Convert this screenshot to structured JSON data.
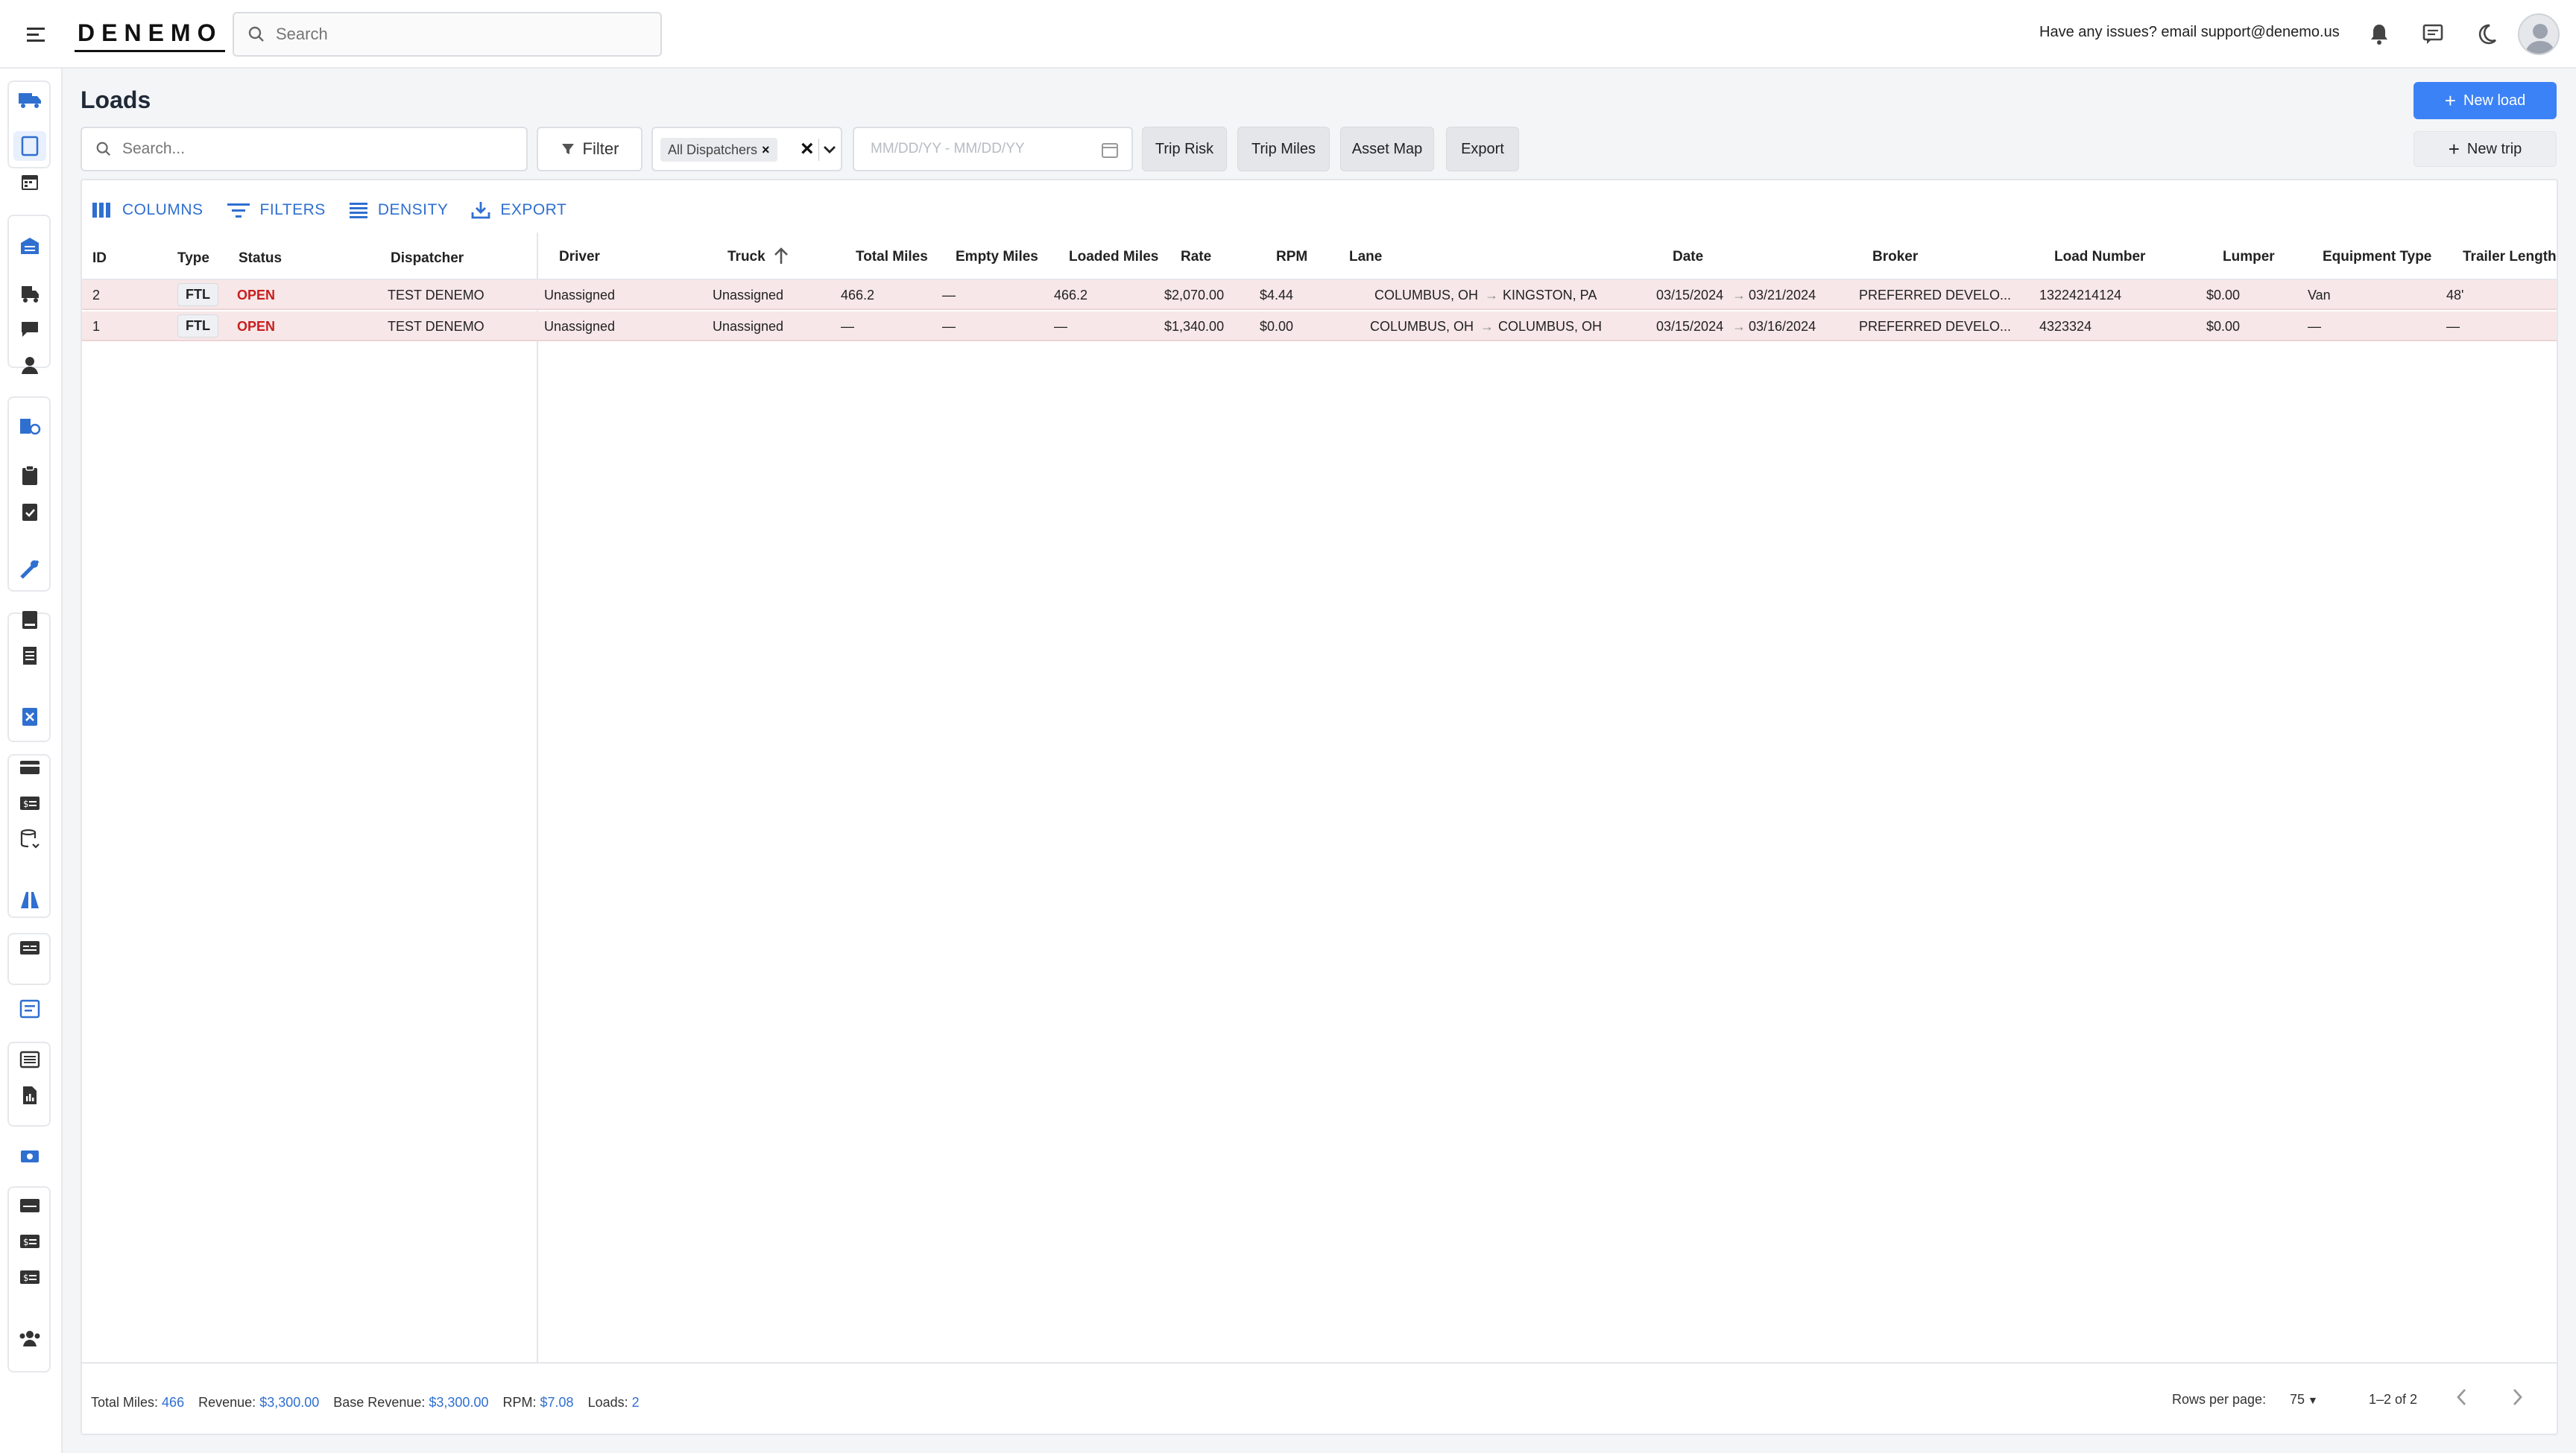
{
  "topbar": {
    "brand": "DENEMO",
    "search_placeholder": "Search",
    "support_text": "Have any issues? email support@denemo.us"
  },
  "page": {
    "title": "Loads",
    "new_load_label": "New load",
    "new_trip_label": "New trip"
  },
  "filters": {
    "search_placeholder": "Search...",
    "filter_label": "Filter",
    "dispatcher_chip": "All Dispatchers",
    "date_placeholder": "MM/DD/YY - MM/DD/YY",
    "buttons": [
      "Trip Risk",
      "Trip Miles",
      "Asset Map",
      "Export"
    ]
  },
  "grid_toolbar": {
    "columns": "COLUMNS",
    "filters": "FILTERS",
    "density": "DENSITY",
    "export": "EXPORT"
  },
  "columns": [
    "ID",
    "Type",
    "Status",
    "Dispatcher",
    "Driver",
    "Truck",
    "Total Miles",
    "Empty Miles",
    "Loaded Miles",
    "Rate",
    "RPM",
    "Lane",
    "Date",
    "Broker",
    "Load Number",
    "Lumper",
    "Equipment Type",
    "Trailer Length"
  ],
  "rows": [
    {
      "id": "2",
      "type": "FTL",
      "status": "OPEN",
      "dispatcher": "TEST DENEMO",
      "driver": "Unassigned",
      "truck": "Unassigned",
      "total_miles": "466.2",
      "empty_miles": "—",
      "loaded_miles": "466.2",
      "rate": "$2,070.00",
      "rpm": "$4.44",
      "lane_from": "COLUMBUS, OH",
      "lane_to": "KINGSTON, PA",
      "date_from": "03/15/2024",
      "date_to": "03/21/2024",
      "broker": "PREFERRED DEVELO...",
      "load_number": "13224214124",
      "lumper": "$0.00",
      "equipment": "Van",
      "trailer": "48'"
    },
    {
      "id": "1",
      "type": "FTL",
      "status": "OPEN",
      "dispatcher": "TEST DENEMO",
      "driver": "Unassigned",
      "truck": "Unassigned",
      "total_miles": "—",
      "empty_miles": "—",
      "loaded_miles": "—",
      "rate": "$1,340.00",
      "rpm": "$0.00",
      "lane_from": "COLUMBUS, OH",
      "lane_to": "COLUMBUS, OH",
      "date_from": "03/15/2024",
      "date_to": "03/16/2024",
      "broker": "PREFERRED DEVELO...",
      "load_number": "4323324",
      "lumper": "$0.00",
      "equipment": "—",
      "trailer": "—"
    }
  ],
  "footer": {
    "total_miles_label": "Total Miles:",
    "total_miles": "466",
    "revenue_label": "Revenue:",
    "revenue": "$3,300.00",
    "base_revenue_label": "Base Revenue:",
    "base_revenue": "$3,300.00",
    "rpm_label": "RPM:",
    "rpm": "$7.08",
    "loads_label": "Loads:",
    "loads": "2",
    "rows_per_page_label": "Rows per page:",
    "rows_per_page": "75",
    "range": "1–2 of 2"
  },
  "colors": {
    "accent": "#3b82f6",
    "link": "#2f6fd0",
    "row_bg": "#f7e7e8",
    "status_open": "#c81e1e"
  }
}
